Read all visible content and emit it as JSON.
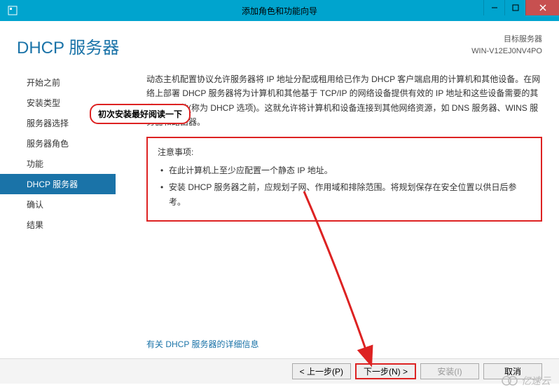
{
  "titlebar": {
    "title": "添加角色和功能向导"
  },
  "header": {
    "page_title": "DHCP 服务器",
    "target_label": "目标服务器",
    "target_name": "WIN-V12EJ0NV4PO"
  },
  "sidebar": {
    "items": [
      {
        "label": "开始之前"
      },
      {
        "label": "安装类型"
      },
      {
        "label": "服务器选择"
      },
      {
        "label": "服务器角色"
      },
      {
        "label": "功能"
      },
      {
        "label": "DHCP 服务器"
      },
      {
        "label": "确认"
      },
      {
        "label": "结果"
      }
    ],
    "active_index": 5
  },
  "annotation": {
    "bubble_text": "初次安装最好阅读一下"
  },
  "content": {
    "intro": "动态主机配置协议允许服务器将 IP 地址分配或租用给已作为 DHCP 客户端启用的计算机和其他设备。在网络上部署 DHCP 服务器将为计算机和其他基于 TCP/IP 的网络设备提供有效的 IP 地址和这些设备需要的其他配置参数(称为 DHCP 选项)。这就允许将计算机和设备连接到其他网络资源，如 DNS 服务器、WINS 服务器和路由器。",
    "notice_title": "注意事项:",
    "notice_items": [
      "在此计算机上至少应配置一个静态 IP 地址。",
      "安装 DHCP 服务器之前，应规划子网、作用域和排除范围。将规划保存在安全位置以供日后参考。"
    ],
    "more_info": "有关 DHCP 服务器的详细信息"
  },
  "buttons": {
    "prev": "< 上一步(P)",
    "next": "下一步(N) >",
    "install": "安装(I)",
    "cancel": "取消"
  },
  "watermark": {
    "text": "亿速云"
  }
}
